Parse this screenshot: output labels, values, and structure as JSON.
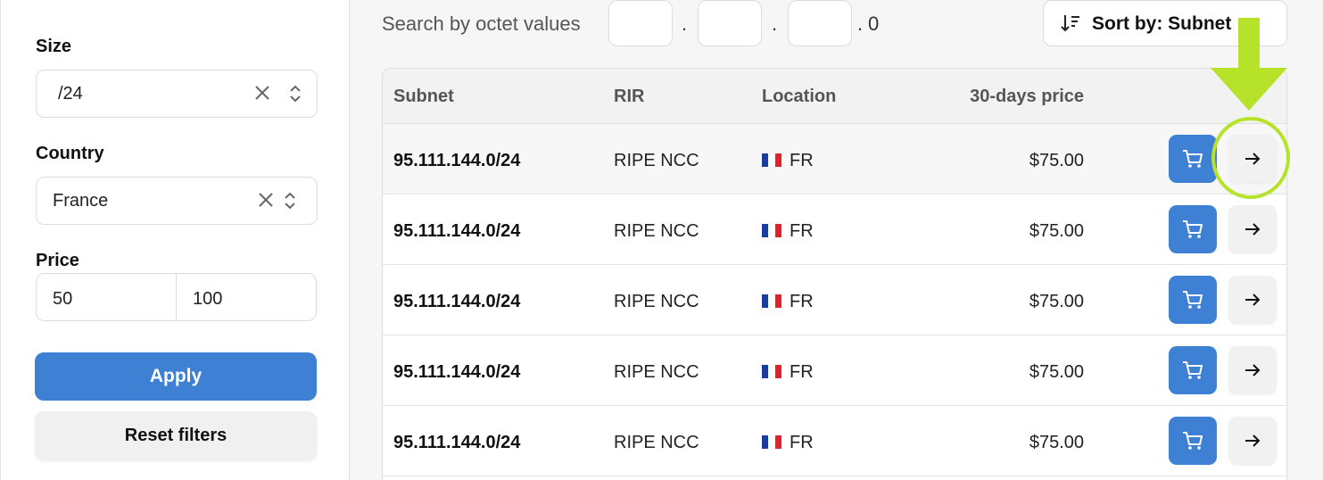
{
  "filters": {
    "size": {
      "label": "Size",
      "value": "/24"
    },
    "country": {
      "label": "Country",
      "value": "France"
    },
    "price": {
      "label": "Price",
      "min": "50",
      "max": "100"
    },
    "apply_label": "Apply",
    "reset_label": "Reset filters"
  },
  "search": {
    "label": "Search by octet values",
    "separator": ".",
    "last_octet": "0"
  },
  "sort": {
    "label": "Sort by: Subnet ↑"
  },
  "table": {
    "columns": [
      "Subnet",
      "RIR",
      "Location",
      "30-days price"
    ],
    "rows": [
      {
        "subnet": "95.111.144.0/24",
        "rir": "RIPE NCC",
        "country": "FR",
        "price": "$75.00"
      },
      {
        "subnet": "95.111.144.0/24",
        "rir": "RIPE NCC",
        "country": "FR",
        "price": "$75.00"
      },
      {
        "subnet": "95.111.144.0/24",
        "rir": "RIPE NCC",
        "country": "FR",
        "price": "$75.00"
      },
      {
        "subnet": "95.111.144.0/24",
        "rir": "RIPE NCC",
        "country": "FR",
        "price": "$75.00"
      },
      {
        "subnet": "95.111.144.0/24",
        "rir": "RIPE NCC",
        "country": "FR",
        "price": "$75.00"
      }
    ]
  },
  "icons": {
    "clear": "close-icon",
    "select_arrows": "chevron-up-down-icon",
    "sort": "sort-icon",
    "cart": "cart-icon",
    "go": "arrow-right-icon",
    "flag": "france-flag-icon"
  },
  "colors": {
    "primary": "#3d80d4",
    "annotation": "#b6e32a",
    "flag_blue": "#1b3c9c",
    "flag_white": "#ffffff",
    "flag_red": "#e1222b"
  }
}
